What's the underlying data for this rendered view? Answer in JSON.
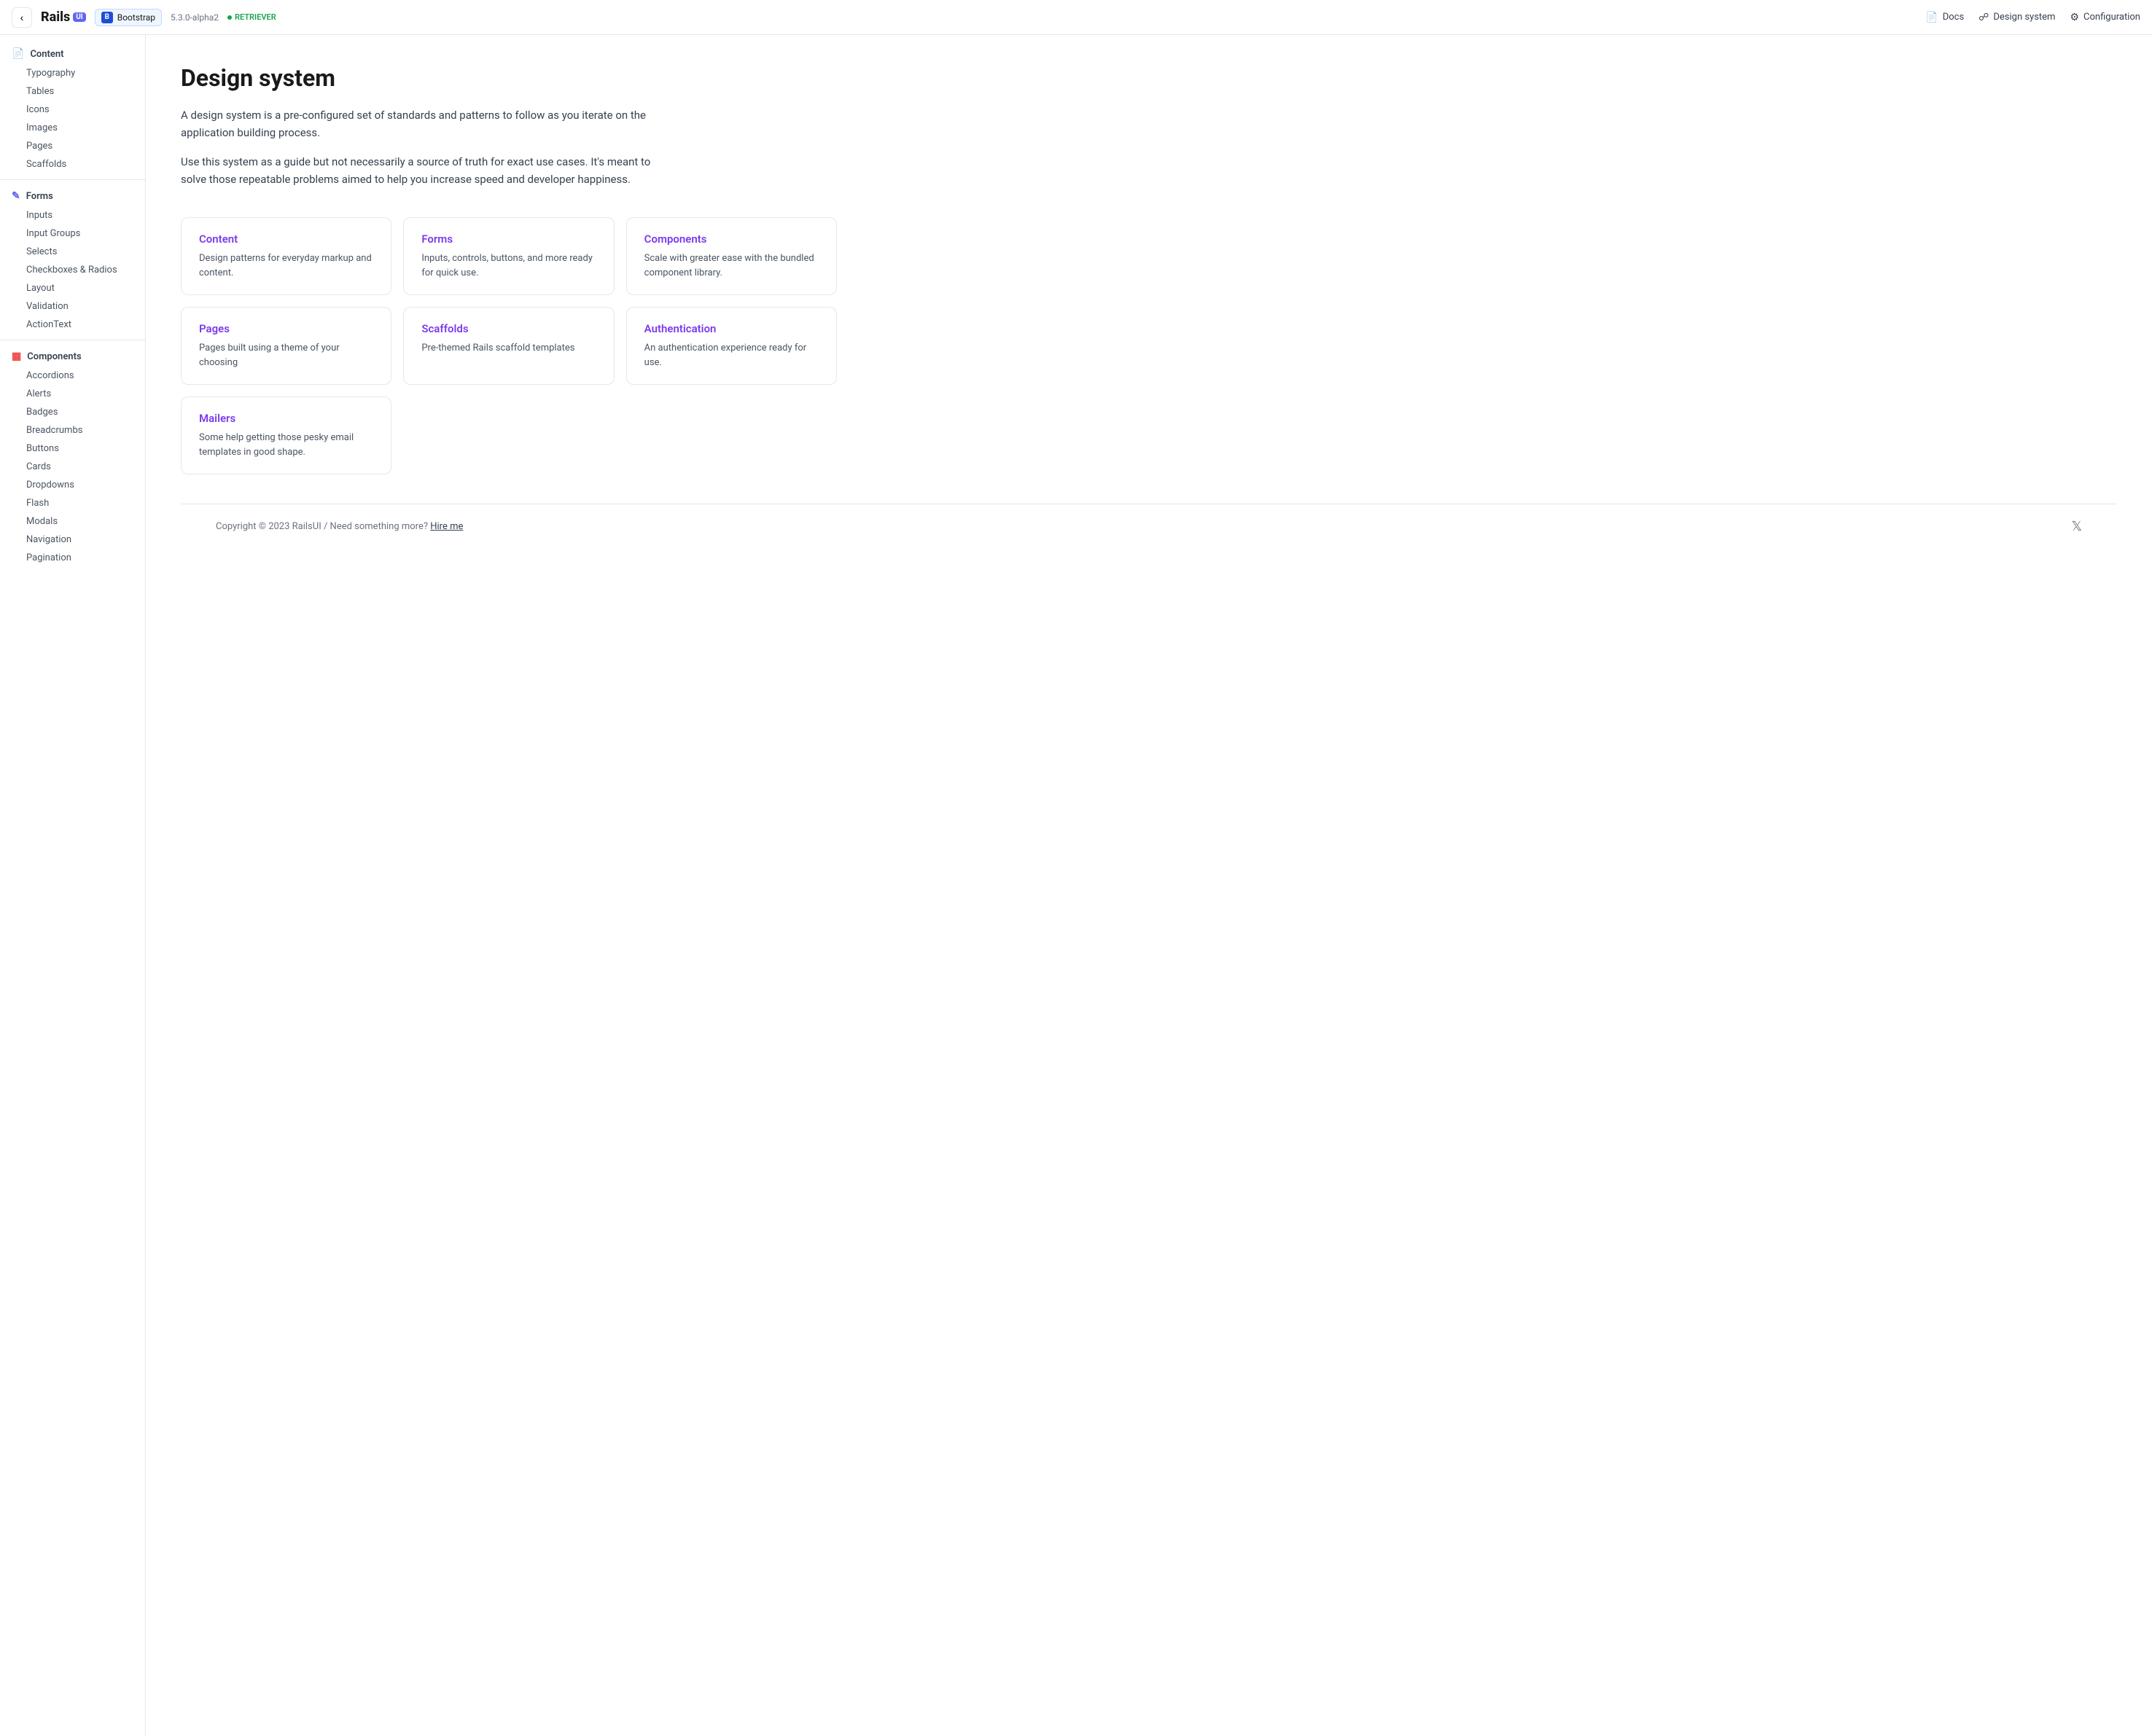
{
  "topnav": {
    "back_label": "‹",
    "logo_text": "Rails",
    "logo_badge": "UI",
    "brand_badge_letter": "B",
    "brand_name": "Bootstrap",
    "version": "5.3.0-alpha2",
    "retriever_label": "RETRIEVER",
    "docs_label": "Docs",
    "design_system_label": "Design system",
    "configuration_label": "Configuration"
  },
  "sidebar": {
    "content_label": "Content",
    "forms_label": "Forms",
    "components_label": "Components",
    "content_items": [
      {
        "label": "Typography"
      },
      {
        "label": "Tables"
      },
      {
        "label": "Icons"
      },
      {
        "label": "Images"
      },
      {
        "label": "Pages"
      },
      {
        "label": "Scaffolds"
      }
    ],
    "forms_items": [
      {
        "label": "Inputs"
      },
      {
        "label": "Input Groups"
      },
      {
        "label": "Selects"
      },
      {
        "label": "Checkboxes & Radios"
      },
      {
        "label": "Layout"
      },
      {
        "label": "Validation"
      },
      {
        "label": "ActionText"
      }
    ],
    "components_items": [
      {
        "label": "Accordions"
      },
      {
        "label": "Alerts"
      },
      {
        "label": "Badges"
      },
      {
        "label": "Breadcrumbs"
      },
      {
        "label": "Buttons"
      },
      {
        "label": "Cards"
      },
      {
        "label": "Dropdowns"
      },
      {
        "label": "Flash"
      },
      {
        "label": "Modals"
      },
      {
        "label": "Navigation"
      },
      {
        "label": "Pagination"
      }
    ]
  },
  "main": {
    "title": "Design system",
    "description1": "A design system is a pre-configured set of standards and patterns to follow as you iterate on the application building process.",
    "description2": "Use this system as a guide but not necessarily a source of truth for exact use cases. It's meant to solve those repeatable problems aimed to help you increase speed and developer happiness.",
    "cards": [
      {
        "title": "Content",
        "description": "Design patterns for everyday markup and content."
      },
      {
        "title": "Forms",
        "description": "Inputs, controls, buttons, and more ready for quick use."
      },
      {
        "title": "Components",
        "description": "Scale with greater ease with the bundled component library."
      },
      {
        "title": "Pages",
        "description": "Pages built using a theme of your choosing"
      },
      {
        "title": "Scaffolds",
        "description": "Pre-themed Rails scaffold templates"
      },
      {
        "title": "Authentication",
        "description": "An authentication experience ready for use."
      },
      {
        "title": "Mailers",
        "description": "Some help getting those pesky email templates in good shape."
      }
    ]
  },
  "footer": {
    "copyright": "Copyright © 2023 RailsUI / Need something more?",
    "hire_link": "Hire me"
  }
}
